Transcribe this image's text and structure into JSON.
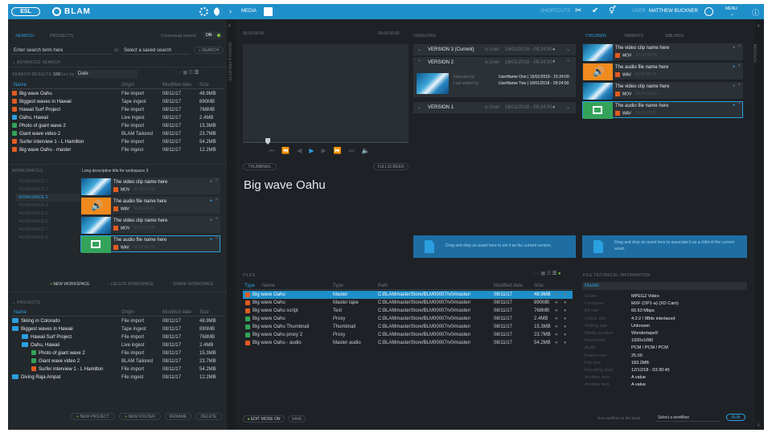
{
  "topbar": {
    "logo": "ESL",
    "app": "BLAM",
    "media": "MEDIA",
    "shortcuts": "SHORTCUTS",
    "user_label": "USER",
    "user_name": "MATTHEW BUCKNER",
    "menu": "MENU"
  },
  "search": {
    "tab_search": "SEARCH",
    "tab_projects": "PROJECTS",
    "contextual": "Contextual search",
    "contextual_state": "ON",
    "input_placeholder": "Enter search term here",
    "or": "or",
    "saved_placeholder": "Select a saved search",
    "search_btn": "SEARCH",
    "advanced": "ADVANCED SEARCH",
    "results_label": "SEARCH RESULTS",
    "results_count": "106",
    "sort_label": "Sort by",
    "sort_value": "Date",
    "cols": [
      "Name",
      "Origin",
      "Modified date",
      "Size"
    ],
    "rows": [
      {
        "name": "Big wave Oahu",
        "origin": "File import",
        "date": "08/11/17",
        "size": "48.9MB",
        "c": "#e25b1f"
      },
      {
        "name": "Biggest waves in Hawaii",
        "origin": "Tape ingest",
        "date": "08/11/17",
        "size": "890MB",
        "c": "#e25b1f"
      },
      {
        "name": "Hawaii Surf Project",
        "origin": "File import",
        "date": "08/11/17",
        "size": "768MB",
        "c": "#e25b1f"
      },
      {
        "name": "Oahu, Hawaii",
        "origin": "Live ingest",
        "date": "08/11/17",
        "size": "2.4MB",
        "c": "#2c9fe0"
      },
      {
        "name": "Photo of giant wave 2",
        "origin": "File import",
        "date": "08/11/17",
        "size": "15.3MB",
        "c": "#34a35a"
      },
      {
        "name": "Giant wave video 2",
        "origin": "BLAM Tailored",
        "date": "08/11/17",
        "size": "23.7MB",
        "c": "#34a35a"
      },
      {
        "name": "Surfer interview 1 - L Hamilton",
        "origin": "File import",
        "date": "08/11/17",
        "size": "54.2MB",
        "c": "#e25b1f"
      },
      {
        "name": "Big wave Oahu - master",
        "origin": "File ingest",
        "date": "08/11/17",
        "size": "12.2MB",
        "c": "#e25b1f"
      }
    ]
  },
  "workspaces": {
    "title": "WORKSPACES",
    "desc": "Long descriptive title for workspace 3",
    "items": [
      "WORKSPACE 1",
      "WORKSPACE 2",
      "WORKSPACE 3",
      "WORKSPACE 4",
      "WORKSPACE 5",
      "WORKSPACE 6",
      "WORKSPACE 7",
      "WORKSPACE 8"
    ],
    "cards": [
      {
        "title": "The video clip name here",
        "type": "MOV",
        "time": "00:00:00:00",
        "kind": "wave"
      },
      {
        "title": "The audio file name here",
        "type": "WAV",
        "time": "00:00:00:00",
        "kind": "audio"
      },
      {
        "title": "The video clip name here",
        "type": "MOV",
        "time": "00:00:00:00",
        "kind": "wave"
      },
      {
        "title": "The audio file name here",
        "type": "WAV",
        "time": "00:00:00:00",
        "kind": "img"
      }
    ],
    "new_btn": "NEW WORKSPACE",
    "delete_btn": "DELETE WORKSPACE",
    "share_btn": "SHARE WORKSPACE"
  },
  "projects": {
    "title": "PROJECTS",
    "cols": [
      "Name",
      "Origin",
      "Modified date",
      "Size"
    ],
    "rows": [
      {
        "name": "Skiing in Colorado",
        "origin": "File import",
        "date": "08/11/17",
        "size": "48.9MB",
        "indent": 0,
        "folder": true
      },
      {
        "name": "Biggest waves in Hawaii",
        "origin": "Tape ingest",
        "date": "08/11/17",
        "size": "890MB",
        "indent": 0,
        "folder": true
      },
      {
        "name": "Hawaii Surf Project",
        "origin": "File import",
        "date": "08/11/17",
        "size": "768MB",
        "indent": 1,
        "folder": true
      },
      {
        "name": "Oahu, Hawaii",
        "origin": "Live ingest",
        "date": "08/11/17",
        "size": "2.4MB",
        "indent": 1,
        "folder": true
      },
      {
        "name": "Photo of giant wave 2",
        "origin": "File import",
        "date": "08/11/17",
        "size": "15.3MB",
        "indent": 2,
        "folder": false,
        "c": "#34a35a"
      },
      {
        "name": "Giant wave video 2",
        "origin": "BLAM Tailored",
        "date": "08/11/17",
        "size": "23.7MB",
        "indent": 2,
        "folder": false,
        "c": "#34a35a"
      },
      {
        "name": "Surfer interview 1 - L Hamilton",
        "origin": "File import",
        "date": "08/11/17",
        "size": "54.2MB",
        "indent": 2,
        "folder": false,
        "c": "#e25b1f"
      },
      {
        "name": "Diving Raja Ampat",
        "origin": "File ingest",
        "date": "08/11/17",
        "size": "12.2MB",
        "indent": 0,
        "folder": true
      }
    ],
    "new_project": "NEW PROJECT",
    "new_folder": "NEW FOLDER",
    "rename": "RENAME",
    "delete": "DELETE"
  },
  "player": {
    "tc_left": "00:00:00:00",
    "tc_right": "00:00:00:00",
    "thumbnail": "THUMBNAIL",
    "fullscreen": "FULLSCREEN",
    "title": "Big wave Oahu"
  },
  "versions": {
    "title": "VERSIONS",
    "v3": "VERSION 3 (Current)",
    "v2": "VERSION 2",
    "v1": "VERSION 1",
    "user": "User",
    "date": "16/01/2018 - 09:24:00",
    "imported_by": "Imported by",
    "edited_by": "Last edited by",
    "imp_val": "UserName One | 15/01/2018 - 15:24:00",
    "edit_val": "UserName Two | 16/01/2018 - 09:24:00",
    "drop": "Drag and drop an asset here to set it as the current version."
  },
  "children": {
    "tabs": [
      "CHILDREN",
      "PARENTS",
      "SIBLINGS"
    ],
    "items": [
      {
        "title": "The video clip name here",
        "type": "MOV",
        "time": "00:00:00:00",
        "kind": "wave"
      },
      {
        "title": "The audio file name here",
        "type": "WAV",
        "time": "00:00:00:00",
        "kind": "audio"
      },
      {
        "title": "The video clip name here",
        "type": "MOV",
        "time": "00:00:00:00",
        "kind": "wave"
      },
      {
        "title": "The audio file name here",
        "type": "WAV",
        "time": "00:00:00:00",
        "kind": "img"
      }
    ],
    "drop": "Drag and drop an asset here to associate it as a child of the current asset."
  },
  "files": {
    "title": "FILES",
    "cols": [
      "Type",
      "Name",
      "Type",
      "Path",
      "Modified date",
      "Size"
    ],
    "rows": [
      {
        "name": "Big wave Oahu",
        "type": "Master",
        "path": "C:BLAMmasterStore/BLM00007/v0/master/",
        "date": "08/11/17",
        "size": "48.9MB",
        "c": "#e25b1f"
      },
      {
        "name": "Big wave Oahu",
        "type": "Master tape",
        "path": "C:BLAMmasterStore/BLM00007/v0/master/",
        "date": "08/11/17",
        "size": "890MB",
        "c": "#e25b1f"
      },
      {
        "name": "Big wave Oahu script",
        "type": "Text",
        "path": "C:BLAMmasterStore/BLM00007/v0/master/",
        "date": "08/11/17",
        "size": "768MB",
        "c": "#e25b1f"
      },
      {
        "name": "Big wave Oahu",
        "type": "Proxy",
        "path": "C:BLAMmasterStore/BLM00007/v0/master/",
        "date": "08/11/17",
        "size": "2.4MB",
        "c": "#34a35a"
      },
      {
        "name": "Big wave Oahu Thumbnail",
        "type": "Thumbnail",
        "path": "C:BLAMmasterStore/BLM00007/v0/master/",
        "date": "08/11/17",
        "size": "15.3MB",
        "c": "#34a35a"
      },
      {
        "name": "Big wave Oahu proxy 2",
        "type": "Proxy",
        "path": "C:BLAMmasterStore/BLM00007/v0/master/",
        "date": "08/11/17",
        "size": "23.7MB",
        "c": "#34a35a"
      },
      {
        "name": "Big wave Oahu - audio",
        "type": "Master audio",
        "path": "C:BLAMmasterStore/BLM00007/v0/master/",
        "date": "08/11/17",
        "size": "54.2MB",
        "c": "#e25b1f"
      }
    ],
    "edit_mode": "EDIT MODE ON",
    "save": "SAVE"
  },
  "tech": {
    "title": "FILE TECHNICAL INFORMATION",
    "section": "Master",
    "rows": [
      [
        "Codec",
        "MPEG2 Video"
      ],
      [
        "Container",
        "MXF (OP1-a) (XD Cam)"
      ],
      [
        "Bit rate",
        "60.53 Mbps"
      ],
      [
        "Colour info",
        "4:2:2 / 8Bits interlaced"
      ],
      [
        "Writing app",
        "Unknown"
      ],
      [
        "Media location",
        "Wondertape9"
      ],
      [
        "Resolution",
        "1920x1080"
      ],
      [
        "Audio",
        "PCM / PCM / PCM"
      ],
      [
        "Frame rate",
        "25.00"
      ],
      [
        "File size",
        "183.2MB"
      ],
      [
        "Encoding date",
        "12/12/18 - 03:30:45"
      ],
      [
        "Another item",
        "A value"
      ],
      [
        "Another item",
        "A value"
      ]
    ],
    "workflow_label": "Run workflow on this asset",
    "workflow_select": "Select a workflow",
    "run": "RUN"
  },
  "sidebar": {
    "left": "SEARCH & PROJECTS",
    "right": "METADATA"
  }
}
